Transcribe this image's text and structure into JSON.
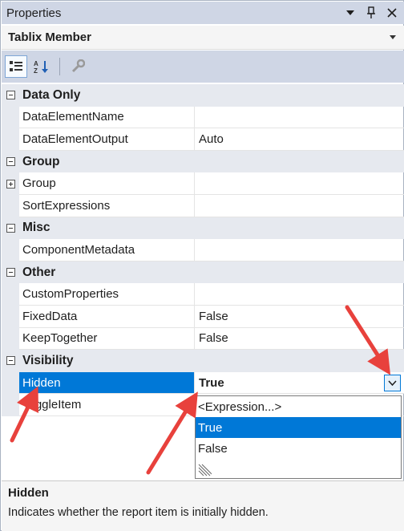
{
  "window": {
    "title": "Properties",
    "buttons": [
      "dropdown-icon",
      "pin-icon",
      "close-icon"
    ]
  },
  "object_selector": {
    "name": "Tablix Member"
  },
  "toolbar": {
    "tools": [
      "categorized-icon",
      "alphabetical-icon",
      "property-pages-icon"
    ]
  },
  "grid": {
    "rows": [
      {
        "type": "category",
        "label": "Data Only"
      },
      {
        "type": "property",
        "name": "DataElementName",
        "value": ""
      },
      {
        "type": "property",
        "name": "DataElementOutput",
        "value": "Auto"
      },
      {
        "type": "category",
        "label": "Group"
      },
      {
        "type": "property",
        "name": "Group",
        "value": "",
        "expandable": true
      },
      {
        "type": "property",
        "name": "SortExpressions",
        "value": ""
      },
      {
        "type": "category",
        "label": "Misc"
      },
      {
        "type": "property",
        "name": "ComponentMetadata",
        "value": ""
      },
      {
        "type": "category",
        "label": "Other"
      },
      {
        "type": "property",
        "name": "CustomProperties",
        "value": ""
      },
      {
        "type": "property",
        "name": "FixedData",
        "value": "False"
      },
      {
        "type": "property",
        "name": "KeepTogether",
        "value": "False"
      },
      {
        "type": "category",
        "label": "Visibility"
      },
      {
        "type": "property",
        "name": "Hidden",
        "value": "True",
        "selected": true
      },
      {
        "type": "property",
        "name": "ToggleItem",
        "value": ""
      }
    ]
  },
  "dropdown": {
    "options": [
      "<Expression...>",
      "True",
      "False"
    ],
    "selected": "True"
  },
  "description": {
    "title": "Hidden",
    "text": "Indicates whether the report item is initially hidden."
  },
  "colors": {
    "accent": "#0078d7",
    "arrow": "#e8413c",
    "header": "#cfd6e5"
  }
}
